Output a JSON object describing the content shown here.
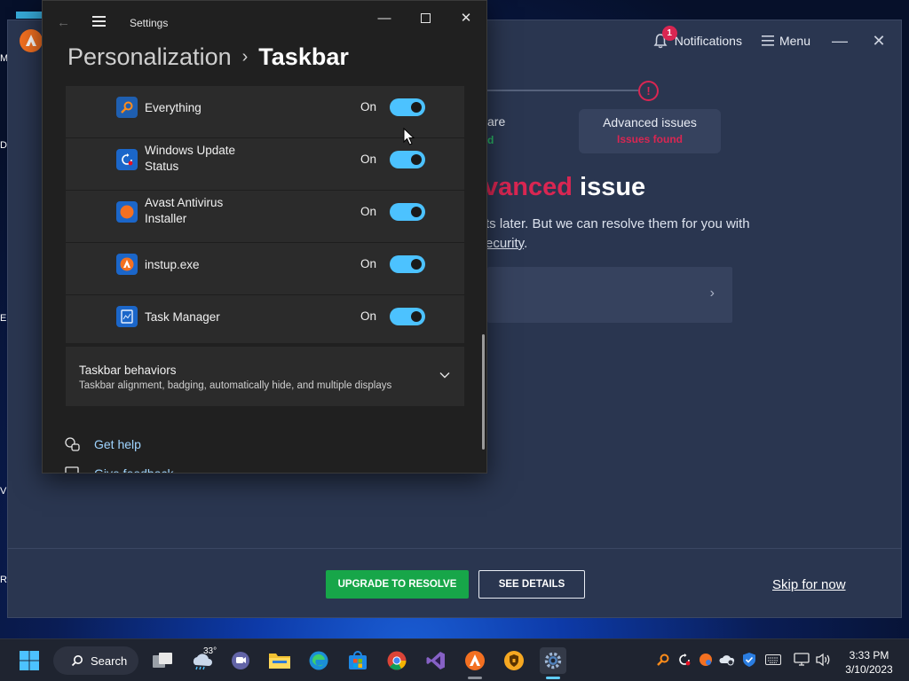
{
  "wallpaper_stubs": [
    "M",
    "D",
    "E",
    "V",
    "R"
  ],
  "avast": {
    "notifications_badge": "1",
    "notifications_label": "Notifications",
    "menu_label": "Menu",
    "progress_mark": "!",
    "step_left_title": "are",
    "step_left_status": "d",
    "step_card_title": "Advanced issues",
    "step_card_status": "Issues found",
    "headline_red": "vanced",
    "headline_white": "issue",
    "sub_line1": "ts later. But we can resolve them for you with",
    "sub_line2_link": "ecurity",
    "sub_line2_end": ".",
    "upgrade_label": "UPGRADE TO RESOLVE",
    "details_label": "SEE DETAILS",
    "skip_label": "Skip for now",
    "colors": {
      "accent_red": "#d92652",
      "accent_green": "#17a649",
      "brand_orange": "#f37021"
    }
  },
  "settings": {
    "app_title": "Settings",
    "breadcrumb_parent": "Personalization",
    "breadcrumb_current": "Taskbar",
    "rows": [
      {
        "name": "Everything",
        "state": "On",
        "icon": "everything-search-icon",
        "on": true
      },
      {
        "name": "Windows Update Status",
        "state": "On",
        "icon": "windows-update-icon",
        "on": true
      },
      {
        "name": "Avast Antivirus Installer",
        "state": "On",
        "icon": "avast-installer-icon",
        "on": true
      },
      {
        "name": "instup.exe",
        "state": "On",
        "icon": "avast-instup-icon",
        "on": true
      },
      {
        "name": "Task Manager",
        "state": "On",
        "icon": "task-manager-icon",
        "on": true
      }
    ],
    "behaviors_title": "Taskbar behaviors",
    "behaviors_desc": "Taskbar alignment, badging, automatically hide, and multiple displays",
    "get_help": "Get help",
    "give_feedback": "Give feedback",
    "colors": {
      "toggle_on": "#4cc2ff",
      "link": "#9fd4ff"
    }
  },
  "taskbar": {
    "search_label": "Search",
    "weather_temp": "33°",
    "time": "3:33 PM",
    "date": "3/10/2023",
    "apps": [
      "start",
      "search",
      "task-view",
      "weather",
      "teams",
      "file-explorer",
      "edge",
      "store",
      "chrome",
      "visual-studio",
      "avast",
      "vpn",
      "settings"
    ],
    "tray": [
      "everything",
      "windows-update",
      "avast",
      "onedrive",
      "defender",
      "keyboard",
      "network",
      "volume"
    ]
  }
}
